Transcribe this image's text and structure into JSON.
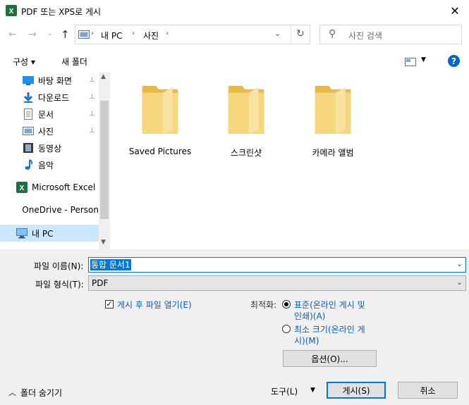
{
  "window": {
    "title": "PDF 또는 XPS로 게시",
    "close_glyph": "✕"
  },
  "nav": {
    "back_glyph": "←",
    "forward_glyph": "→",
    "dropdown_glyph": "⌄",
    "up_glyph": "↑",
    "breadcrumb": [
      "내 PC",
      "사진"
    ],
    "separator": "›",
    "refresh_glyph": "↻",
    "search_placeholder": "사진 검색",
    "search_glyph": "⚲"
  },
  "toolbar": {
    "organize_label": "구성 ▾",
    "new_folder_label": "새 폴더",
    "help_glyph": "?"
  },
  "sidebar": {
    "items": [
      {
        "label": "바탕 화면",
        "icon": "desktop-icon",
        "pinned": true
      },
      {
        "label": "다운로드",
        "icon": "download-icon",
        "pinned": true
      },
      {
        "label": "문서",
        "icon": "document-icon",
        "pinned": true
      },
      {
        "label": "사진",
        "icon": "picture-icon",
        "pinned": true
      },
      {
        "label": "동영상",
        "icon": "video-icon",
        "pinned": false
      },
      {
        "label": "음악",
        "icon": "music-icon",
        "pinned": false
      },
      {
        "label": "Microsoft Excel",
        "icon": "excel-icon",
        "pinned": false
      },
      {
        "label": "OneDrive - Person",
        "icon": "onedrive-icon",
        "pinned": false
      },
      {
        "label": "내 PC",
        "icon": "pc-icon",
        "pinned": false
      }
    ],
    "pin_glyph": "📌"
  },
  "folders": [
    {
      "label": "Saved Pictures"
    },
    {
      "label": "스크린샷"
    },
    {
      "label": "카메라 앨범"
    }
  ],
  "form": {
    "filename_label": "파일 이름(N):",
    "filename_value": "통합 문서1",
    "filetype_label": "파일 형식(T):",
    "filetype_value": "PDF",
    "open_after_label": "게시 후 파일 열기(E)",
    "optimize_label": "최적화:",
    "standard_label_1": "표준(온라인 게시 및",
    "standard_label_2": "인쇄)(A)",
    "minimum_label_1": "최소 크기(온라인 게",
    "minimum_label_2": "시)(M)",
    "options_button": "옵션(O)...",
    "hide_folders": "폴더 숨기기",
    "tools_label": "도구(L)",
    "publish_button": "게시(S)",
    "cancel_button": "취소"
  },
  "colors": {
    "folder": "#f3cd6b",
    "folder_dark": "#e8b849",
    "accent": "#0078d7",
    "link": "#0b5ab4",
    "selection": "#cce8ff"
  }
}
